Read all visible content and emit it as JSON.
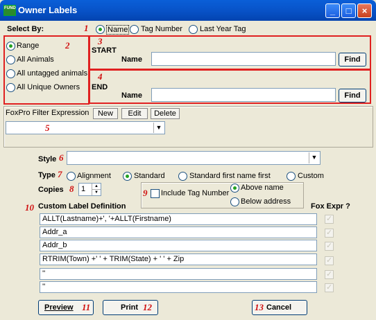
{
  "window": {
    "title": "Owner Labels",
    "icon_label": "FUND",
    "buttons": [
      "_",
      "□",
      "×"
    ]
  },
  "select_by": {
    "label": "Select By:",
    "options": [
      "Name",
      "Tag Number",
      "Last Year Tag"
    ],
    "selected": "Name"
  },
  "range_group": {
    "options": [
      "Range",
      "All Animals",
      "All untagged animals",
      "All Unique Owners"
    ],
    "selected": "Range"
  },
  "start": {
    "heading": "START",
    "name_label": "Name",
    "value": "",
    "find_label": "Find"
  },
  "end": {
    "heading": "END",
    "name_label": "Name",
    "value": "",
    "find_label": "Find"
  },
  "foxpro": {
    "label": "FoxPro Filter Expression",
    "buttons": [
      "New",
      "Edit",
      "Delete"
    ],
    "value": ""
  },
  "style": {
    "label": "Style",
    "value": ""
  },
  "type": {
    "label": "Type",
    "options": [
      "Alignment",
      "Standard",
      "Standard first name first",
      "Custom"
    ],
    "selected": "Standard"
  },
  "copies": {
    "label": "Copies",
    "value": "1"
  },
  "tag": {
    "include_label": "Include Tag Number",
    "include_checked": false,
    "positions": [
      "Above name",
      "Below address"
    ],
    "selected": "Above name"
  },
  "custom": {
    "label": "Custom Label Definition",
    "fox_expr_label": "Fox Expr ?",
    "rows": [
      "ALLT(Lastname)+', '+ALLT(Firstname)",
      "Addr_a",
      "Addr_b",
      "RTRIM(Town) +'  ' + TRIM(State) + ' ' + Zip",
      "''",
      "''"
    ]
  },
  "actions": {
    "preview": "Preview",
    "print": "Print",
    "cancel": "Cancel"
  },
  "markers": [
    "1",
    "2",
    "3",
    "4",
    "5",
    "6",
    "7",
    "8",
    "9",
    "10",
    "11",
    "12",
    "13"
  ],
  "colors": {
    "annotation": "#e02020",
    "titlebar": "#0a5fd8",
    "dialog_bg": "#ece9d8"
  }
}
